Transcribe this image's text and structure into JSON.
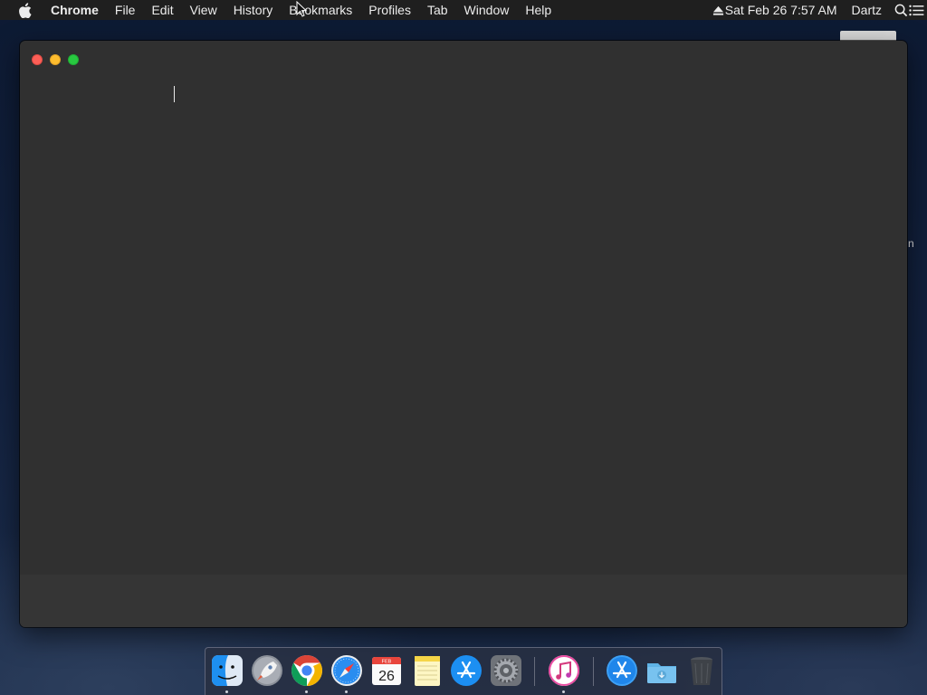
{
  "menubar": {
    "apple_icon": "apple-logo-icon",
    "app_name": "Chrome",
    "menus": [
      "File",
      "Edit",
      "View",
      "History",
      "Bookmarks",
      "Profiles",
      "Tab",
      "Window",
      "Help"
    ],
    "clock": "Sat Feb 26  7:57 AM",
    "user": "Dartz",
    "icons": [
      "eject-icon",
      "spotlight-search-icon",
      "notification-center-icon"
    ]
  },
  "desktop": {
    "partial_label": "n"
  },
  "window": {
    "buttons": [
      "close",
      "minimize",
      "zoom"
    ],
    "content": ""
  },
  "dock": {
    "items": [
      {
        "name": "Finder",
        "icon": "finder-icon",
        "running": true
      },
      {
        "name": "Launchpad",
        "icon": "launchpad-icon",
        "running": false
      },
      {
        "name": "Google Chrome",
        "icon": "chrome-icon",
        "running": true
      },
      {
        "name": "Safari",
        "icon": "safari-icon",
        "running": true
      },
      {
        "name": "Calendar",
        "icon": "calendar-icon",
        "running": false,
        "month": "FEB",
        "day": "26"
      },
      {
        "name": "Notes",
        "icon": "notes-icon",
        "running": false
      },
      {
        "name": "App Store",
        "icon": "app-store-icon",
        "running": false
      },
      {
        "name": "System Preferences",
        "icon": "system-preferences-icon",
        "running": false
      },
      {
        "name": "iTunes",
        "icon": "itunes-icon",
        "running": true
      },
      {
        "name": "Applications",
        "icon": "applications-folder-icon",
        "running": false
      },
      {
        "name": "Downloads",
        "icon": "downloads-folder-icon",
        "running": false
      },
      {
        "name": "Trash",
        "icon": "trash-icon",
        "running": false
      }
    ]
  },
  "colors": {
    "menubar_bg": "#1f1f1f",
    "window_bg": "#303030",
    "close": "#fc5f57",
    "minimize": "#fdbc2e",
    "zoom": "#28c840"
  }
}
